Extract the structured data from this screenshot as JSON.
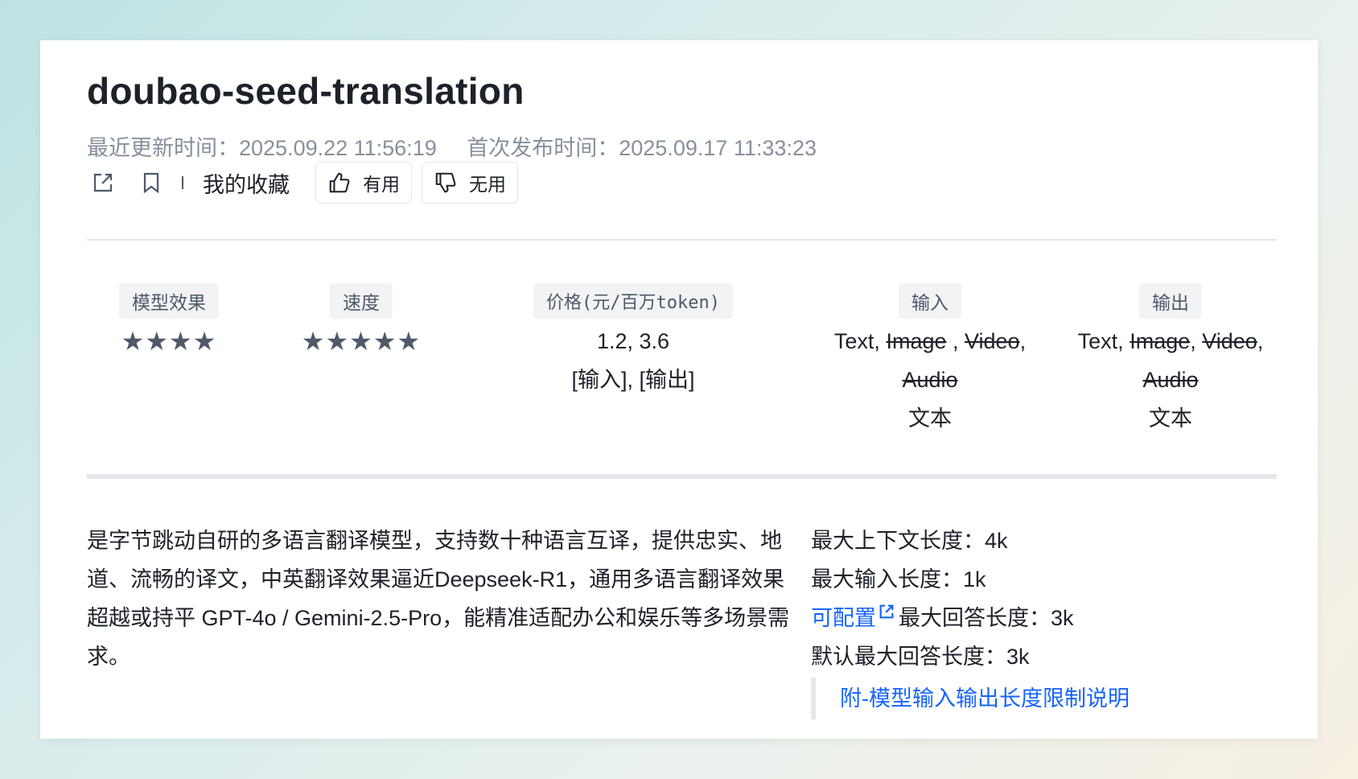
{
  "model": {
    "title": "doubao-seed-translation",
    "updated_label": "最近更新时间：",
    "updated_value": "2025.09.22 11:56:19",
    "published_label": "首次发布时间：",
    "published_value": "2025.09.17 11:33:23"
  },
  "actions": {
    "favorites_label": "我的收藏",
    "useful_label": "有用",
    "useless_label": "无用"
  },
  "stats": {
    "quality": {
      "label": "模型效果",
      "stars": "★★★★",
      "rating": 4
    },
    "speed": {
      "label": "速度",
      "stars": "★★★★★",
      "rating": 5
    },
    "price": {
      "label": "价格(元/百万token)",
      "values": "1.2, 3.6",
      "sub": "[输入], [输出]"
    },
    "input": {
      "label": "输入",
      "text": "Text,",
      "image": "Image",
      "sep1": " , ",
      "video": "Video",
      "sep2": ",",
      "audio": "Audio",
      "desc": "文本"
    },
    "output": {
      "label": "输出",
      "text": "Text,",
      "image": "Image",
      "sep1": ", ",
      "video": "Video",
      "sep2": ",",
      "audio": "Audio",
      "desc": "文本"
    }
  },
  "description": "是字节跳动自研的多语言翻译模型，支持数十种语言互译，提供忠实、地道、流畅的译文，中英翻译效果逼近Deepseek-R1，通用多语言翻译效果超越或持平 GPT-4o / Gemini-2.5-Pro，能精准适配办公和娱乐等多场景需求。",
  "specs": {
    "max_context": "最大上下文长度：4k",
    "max_input": "最大输入长度：1k",
    "configurable_link": "可配置",
    "max_answer": "最大回答长度：3k",
    "default_max_answer": "默认最大回答长度：3k",
    "note_link": "附-模型输入输出长度限制说明"
  },
  "colors": {
    "link": "#1664ff",
    "muted": "#86909c",
    "tag_bg": "#f2f3f5"
  }
}
